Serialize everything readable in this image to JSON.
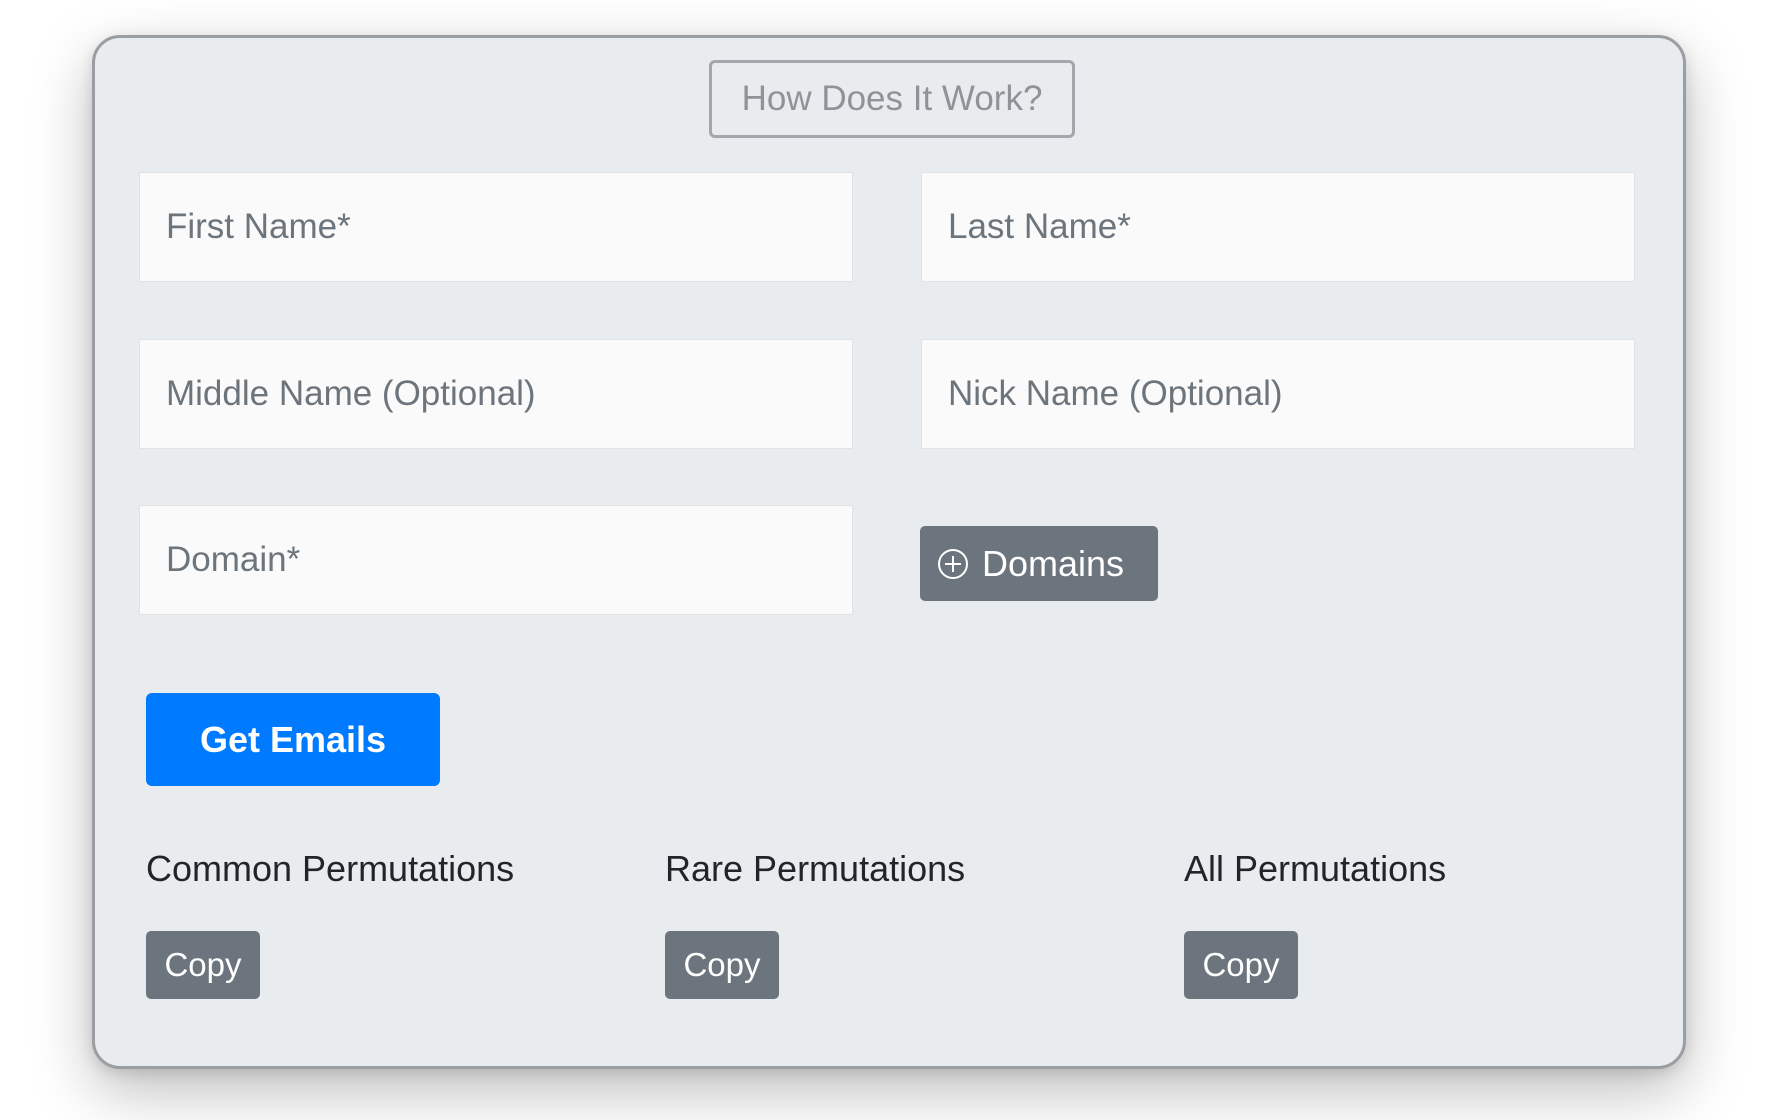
{
  "header": {
    "how_button_label": "How Does It Work?"
  },
  "form": {
    "first_name": {
      "placeholder": "First Name*",
      "value": ""
    },
    "last_name": {
      "placeholder": "Last Name*",
      "value": ""
    },
    "middle_name": {
      "placeholder": "Middle Name (Optional)",
      "value": ""
    },
    "nick_name": {
      "placeholder": "Nick Name (Optional)",
      "value": ""
    },
    "domain": {
      "placeholder": "Domain*",
      "value": ""
    },
    "add_domains_label": "Domains",
    "add_domains_icon": "plus-circle-icon",
    "submit_label": "Get Emails"
  },
  "permutations": [
    {
      "label": "Common Permutations",
      "copy_label": "Copy"
    },
    {
      "label": "Rare Permutations",
      "copy_label": "Copy"
    },
    {
      "label": "All Permutations",
      "copy_label": "Copy"
    }
  ],
  "colors": {
    "card_background": "#e9ecef",
    "primary": "#007bff",
    "secondary": "#6c757d"
  }
}
